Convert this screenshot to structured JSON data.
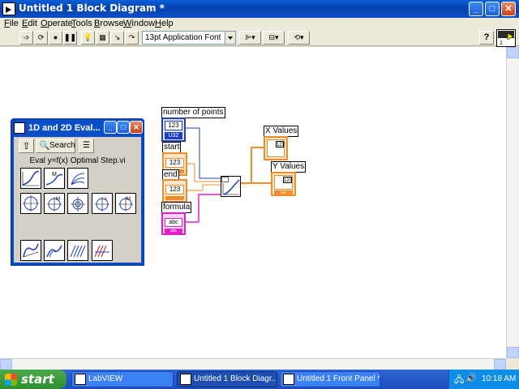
{
  "window": {
    "title": "Untitled 1 Block Diagram *",
    "controls": {
      "minimize": "_",
      "maximize": "□",
      "close": "✕"
    }
  },
  "menu": [
    "File",
    "Edit",
    "Operate",
    "Tools",
    "Browse",
    "Window",
    "Help"
  ],
  "toolbar": {
    "font": "13pt Application Font",
    "help": "?"
  },
  "palette": {
    "title": "1D and 2D Eval...",
    "search_label": "Search",
    "vi_name": "Eval y=f(x) Optimal Step.vi"
  },
  "diagram": {
    "labels": {
      "number_of_points": "number of points",
      "start": "start",
      "end": "end",
      "formula": "formula",
      "x_values": "X Values",
      "y_values": "Y Values"
    },
    "terminal_text": {
      "numeric": "123",
      "int_type": "U32",
      "dbl_type": "DBL",
      "string": "abc",
      "str_type": "abc"
    },
    "colors": {
      "integer": "#1f3fbf",
      "double": "#f28c28",
      "string": "#e020c8",
      "wire_int": "#1f3fbf",
      "wire_dbl": "#f28c28",
      "wire_str": "#e020c8"
    }
  },
  "taskbar": {
    "start": "start",
    "tasks": [
      {
        "label": "LabVIEW"
      },
      {
        "label": "Untitled 1 Block Diagr..."
      },
      {
        "label": "Untitled 1 Front Panel *"
      }
    ],
    "clock": "10:18 AM"
  }
}
